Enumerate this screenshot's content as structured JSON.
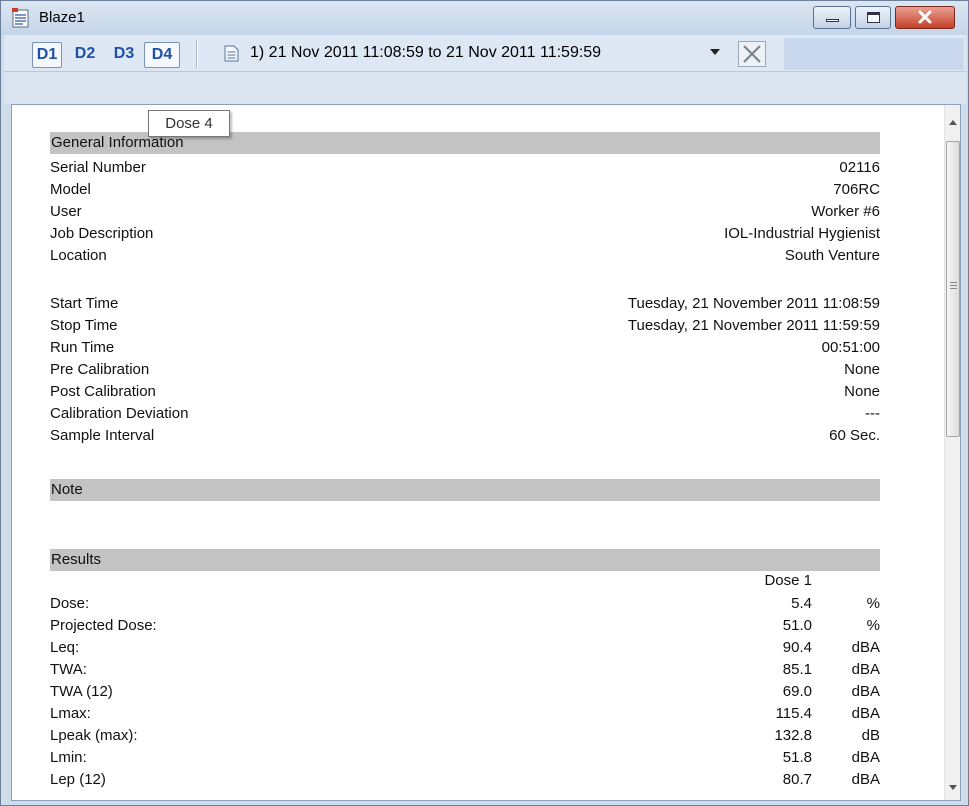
{
  "window": {
    "title": "Blaze1",
    "close_color": "#c5402b"
  },
  "toolbar": {
    "tabs": [
      "D1",
      "D2",
      "D3",
      "D4"
    ],
    "date_range": "1) 21 Nov 2011 11:08:59 to 21 Nov 2011 11:59:59",
    "tooltip": "Dose 4"
  },
  "general": {
    "header": "General Information",
    "rows": [
      {
        "label": "Serial Number",
        "value": "02116"
      },
      {
        "label": "Model",
        "value": "706RC"
      },
      {
        "label": "User",
        "value": "Worker #6"
      },
      {
        "label": "Job Description",
        "value": "IOL-Industrial Hygienist"
      },
      {
        "label": "Location",
        "value": "South Venture"
      }
    ],
    "time_rows": [
      {
        "label": "Start Time",
        "value": "Tuesday, 21 November 2011 11:08:59"
      },
      {
        "label": "Stop Time",
        "value": "Tuesday, 21 November 2011 11:59:59"
      },
      {
        "label": "Run Time",
        "value": "00:51:00"
      },
      {
        "label": "Pre Calibration",
        "value": "None"
      },
      {
        "label": "Post Calibration",
        "value": "None"
      },
      {
        "label": "Calibration Deviation",
        "value": "---"
      },
      {
        "label": "Sample Interval",
        "value": "60 Sec."
      }
    ]
  },
  "note": {
    "header": "Note"
  },
  "results": {
    "header": "Results",
    "column": "Dose 1",
    "rows": [
      {
        "label": "Dose:",
        "value": "5.4",
        "unit": "%"
      },
      {
        "label": "Projected Dose:",
        "value": "51.0",
        "unit": "%"
      },
      {
        "label": "Leq:",
        "value": "90.4",
        "unit": "dBA"
      },
      {
        "label": "TWA:",
        "value": "85.1",
        "unit": "dBA"
      },
      {
        "label": "TWA (12)",
        "value": "69.0",
        "unit": "dBA"
      },
      {
        "label": "Lmax:",
        "value": "115.4",
        "unit": "dBA"
      },
      {
        "label": "Lpeak (max):",
        "value": "132.8",
        "unit": "dB"
      },
      {
        "label": "Lmin:",
        "value": "51.8",
        "unit": "dBA"
      },
      {
        "label": "Lep (12)",
        "value": "80.7",
        "unit": "dBA"
      }
    ]
  }
}
